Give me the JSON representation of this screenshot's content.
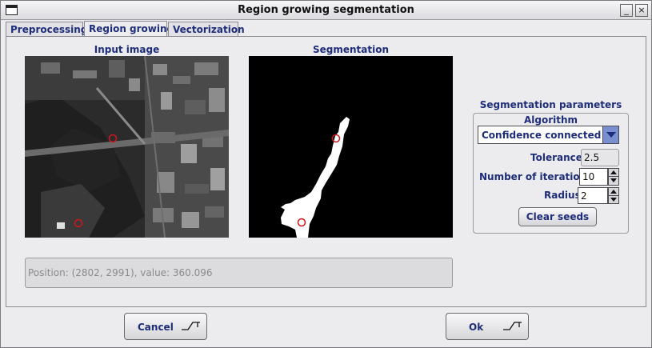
{
  "window": {
    "title": "Region growing segmentation",
    "buttons": {
      "minimize": "_",
      "close": "×"
    }
  },
  "tabs": [
    {
      "label": "Preprocessing",
      "active": false
    },
    {
      "label": "Region growing",
      "active": true
    },
    {
      "label": "Vectorization",
      "active": false
    }
  ],
  "views": {
    "input_caption": "Input image",
    "segmentation_caption": "Segmentation"
  },
  "status": {
    "position_text": "Position: (2802, 2991), value: 360.096"
  },
  "params": {
    "group_title": "Segmentation parameters",
    "algorithm_label": "Algorithm",
    "algorithm_value": "Confidence connected",
    "tolerance_label": "Tolerance",
    "tolerance_value": "2.5",
    "iterations_label": "Number of iterations",
    "iterations_value": "10",
    "radius_label": "Radius",
    "radius_value": "2",
    "clear_seeds_label": "Clear seeds"
  },
  "footer": {
    "cancel_label": "Cancel",
    "ok_label": "Ok"
  },
  "colors": {
    "label_text": "#1e2d7a",
    "seed_marker": "#d0161c",
    "select_arrow_bg": "#7a8fd0"
  }
}
